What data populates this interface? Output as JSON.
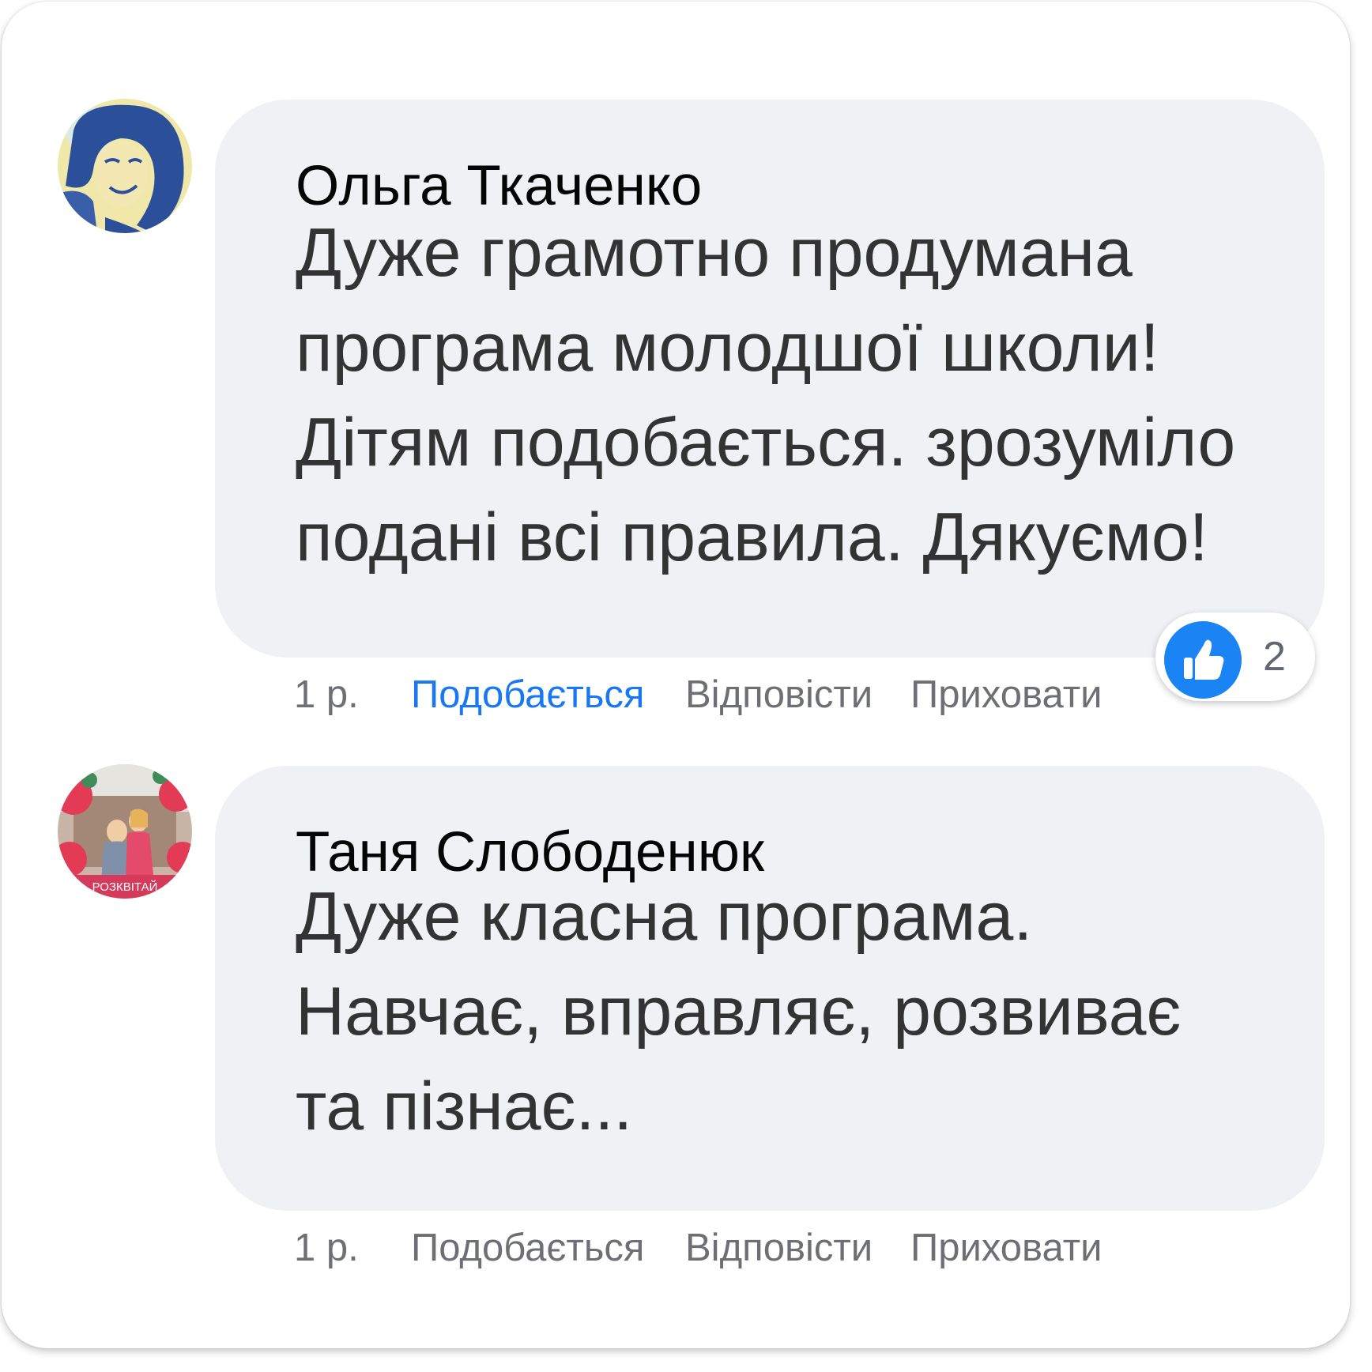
{
  "comments": [
    {
      "author": "Ольга Ткаченко",
      "text_lines": [
        "Дуже грамотно продумана",
        "програма молодшої школи!",
        "Дітям подобається. зрозуміло",
        "подані всі правила. Дякуємо!"
      ],
      "time": "1 р.",
      "like_label": "Подобається",
      "reply_label": "Відповісти",
      "hide_label": "Приховати",
      "liked": true,
      "reaction_count": "2",
      "reaction_icon": "thumbs-up-icon"
    },
    {
      "author": "Таня Слободенюк",
      "text_lines": [
        "Дуже класна програма.",
        "Навчає, вправляє, розвиває",
        "та пізнає..."
      ],
      "time": "1 р.",
      "like_label": "Подобається",
      "reply_label": "Відповісти",
      "hide_label": "Приховати",
      "liked": false,
      "avatar_text": "РОЗКВІТАЙ"
    }
  ],
  "colors": {
    "bubble": "#f0f1f4",
    "liked": "#1877f2",
    "action": "#6d6f74",
    "reaction_blue": "#1b84f4"
  }
}
